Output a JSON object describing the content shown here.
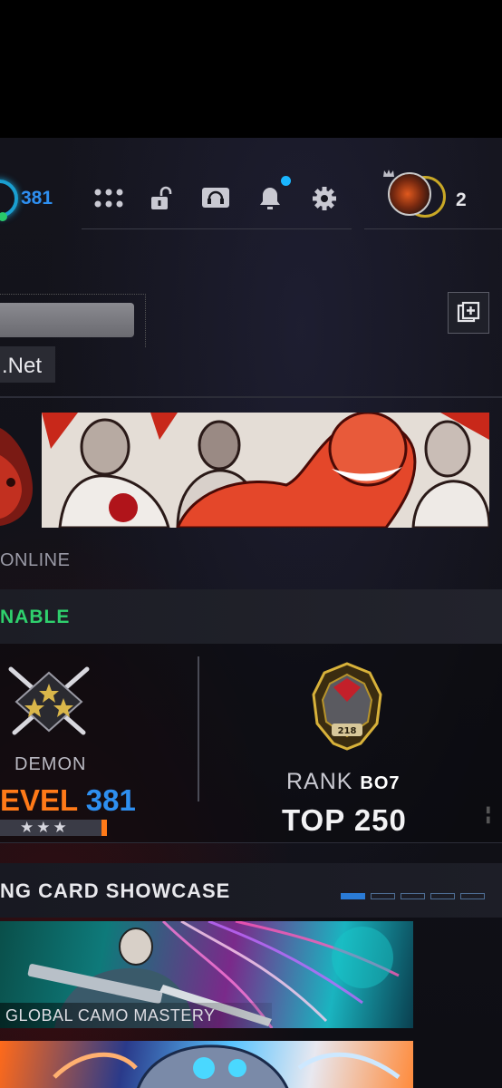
{
  "header": {
    "level_count": "381",
    "currency_count": "2",
    "icons": [
      "grid-icon",
      "unlock-icon",
      "headset-icon",
      "bell-icon",
      "gear-icon"
    ],
    "notification_indicator": true,
    "accent_color": "#2e8ff0"
  },
  "profile": {
    "name_suffix": ".Net",
    "status": "ONLINE",
    "add_button_icon": "add-copy-icon"
  },
  "banner": {
    "text": "NABLE",
    "color": "#2fd06d"
  },
  "stats": {
    "prestige_title": "DEMON",
    "level_word": "EVEL",
    "level_number": "381",
    "stars": "★★★",
    "rank_word": "RANK",
    "rank_game": "BO7",
    "rank_position": "TOP 250",
    "rank_badge_number": "218"
  },
  "showcase": {
    "title": "NG CARD SHOWCASE",
    "pages": 5,
    "active_page": 1,
    "cards": [
      {
        "label": "GLOBAL CAMO MASTERY"
      },
      {
        "label": ""
      }
    ]
  }
}
